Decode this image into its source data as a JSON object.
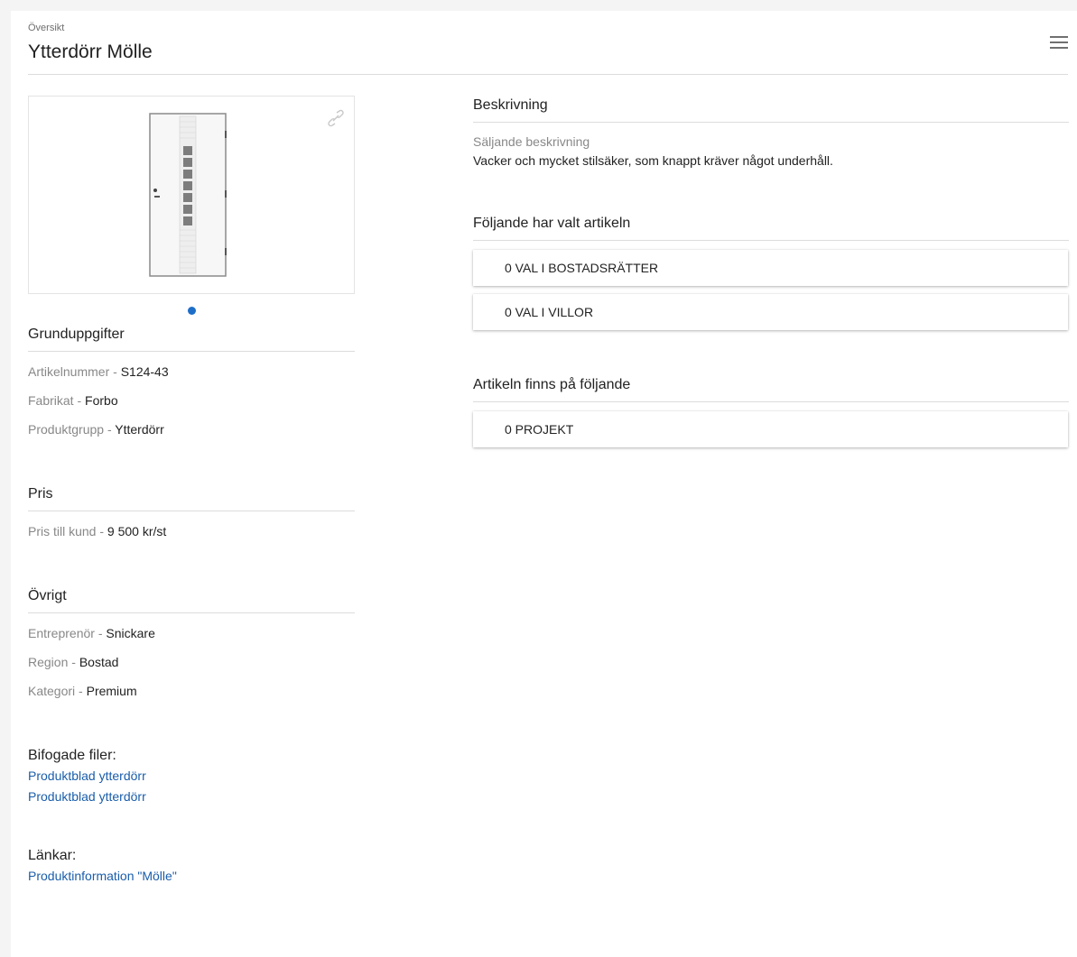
{
  "header": {
    "breadcrumb": "Översikt",
    "title": "Ytterdörr Mölle",
    "menu_icon": "hamburger-menu-icon"
  },
  "image": {
    "alt": "Ytterdörr Mölle",
    "link_icon": "link-icon",
    "slide_count": 1,
    "active_slide": 1
  },
  "basic": {
    "title": "Grunduppgifter",
    "rows": [
      {
        "label": "Artikelnummer",
        "sep": " - ",
        "value": "S124-43"
      },
      {
        "label": "Fabrikat",
        "sep": " - ",
        "value": "Forbo"
      },
      {
        "label": "Produktgrupp",
        "sep": " - ",
        "value": "Ytterdörr"
      }
    ]
  },
  "price": {
    "title": "Pris",
    "rows": [
      {
        "label": "Pris till kund",
        "sep": " - ",
        "value": "9 500 kr/st"
      }
    ]
  },
  "other": {
    "title": "Övrigt",
    "rows": [
      {
        "label": "Entreprenör",
        "sep": " - ",
        "value": "Snickare"
      },
      {
        "label": "Region",
        "sep": " - ",
        "value": "Bostad"
      },
      {
        "label": "Kategori",
        "sep": " - ",
        "value": "Premium"
      }
    ]
  },
  "files": {
    "title": "Bifogade filer:",
    "items": [
      "Produktblad ytterdörr",
      "Produktblad ytterdörr"
    ]
  },
  "links": {
    "title": "Länkar:",
    "items": [
      "Produktinformation \"Mölle\""
    ]
  },
  "description": {
    "title": "Beskrivning",
    "label": "Säljande beskrivning",
    "text": "Vacker och mycket stilsäker, som knappt kräver något underhåll."
  },
  "chosen": {
    "title": "Följande har valt artikeln",
    "cards": [
      "0 VAL I BOSTADSRÄTTER",
      "0 VAL I VILLOR"
    ]
  },
  "exists": {
    "title": "Artikeln finns på följande",
    "cards": [
      "0 PROJEKT"
    ]
  },
  "colors": {
    "link": "#1a5dab",
    "dot": "#1e6ec8",
    "divider": "#dcdcdc",
    "muted": "#888888"
  }
}
